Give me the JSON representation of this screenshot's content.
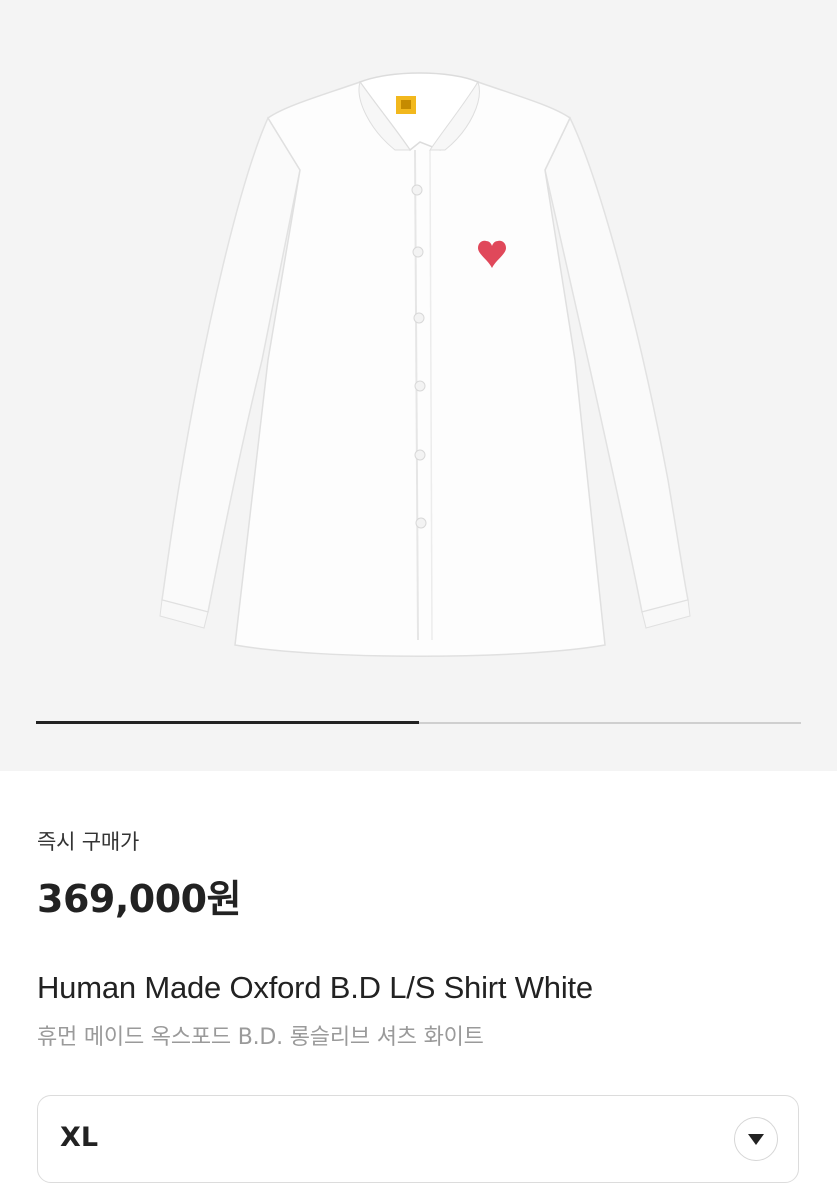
{
  "product_image": {
    "name": "white oxford button-down shirt",
    "background_color": "#f4f4f4",
    "gallery_progress_percent": 50
  },
  "price": {
    "label": "즉시 구매가",
    "value": "369,000원"
  },
  "product": {
    "title_en": "Human Made Oxford B.D L/S Shirt White",
    "title_ko": "휴먼 메이드 옥스포드 B.D. 롱슬리브 셔츠 화이트"
  },
  "size_select": {
    "selected": "XL",
    "icon": "triangle-down-icon"
  },
  "colors": {
    "text_primary": "#222222",
    "text_secondary": "#9a9a9a",
    "logo_heart": "#e0485a",
    "collar_tag": "#f2b81d"
  }
}
